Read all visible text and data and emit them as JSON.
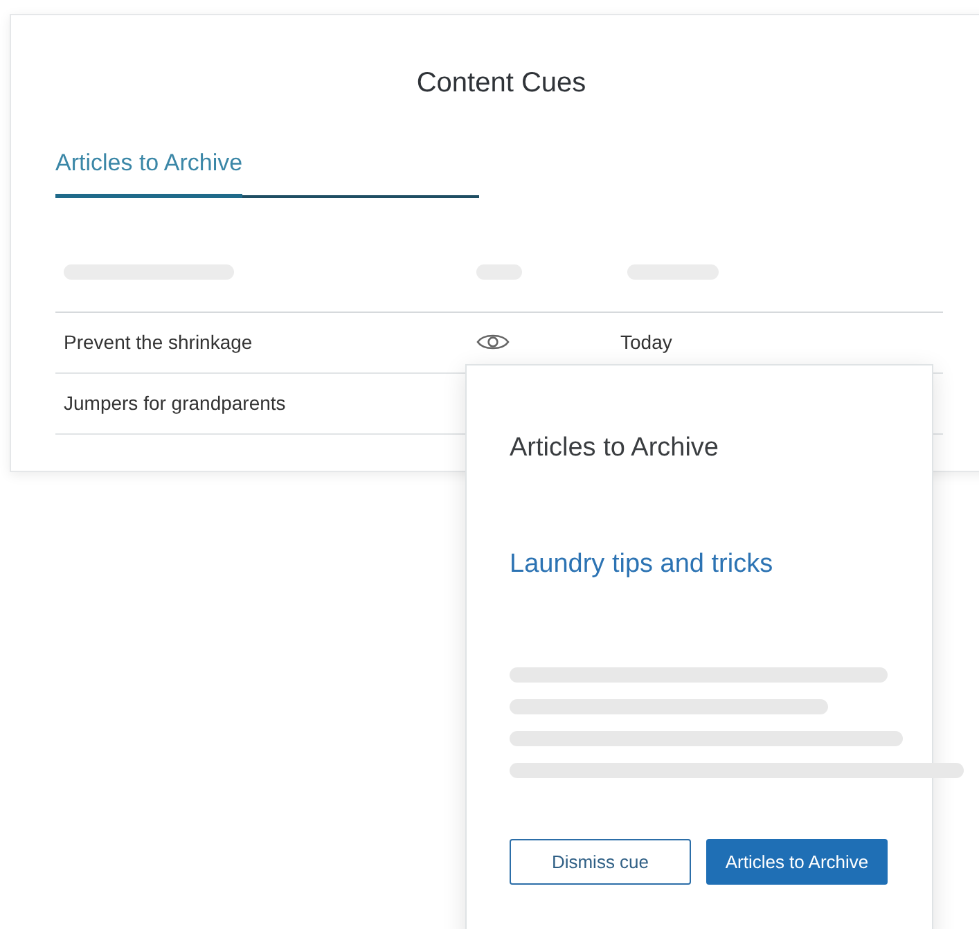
{
  "card": {
    "title": "Content Cues"
  },
  "tabs": [
    {
      "label": "Articles to Archive",
      "selected": true
    }
  ],
  "table": {
    "rows": [
      {
        "title": "Prevent the shrinkage",
        "viewed": true,
        "date": "Today"
      },
      {
        "title": "Jumpers for grandparents"
      }
    ]
  },
  "popover": {
    "heading": "Articles to Archive",
    "link": "Laundry tips and tricks",
    "buttons": [
      {
        "label": "Dismiss cue",
        "kind": "secondary"
      },
      {
        "label": "Articles to Archive",
        "kind": "primary"
      }
    ]
  }
}
